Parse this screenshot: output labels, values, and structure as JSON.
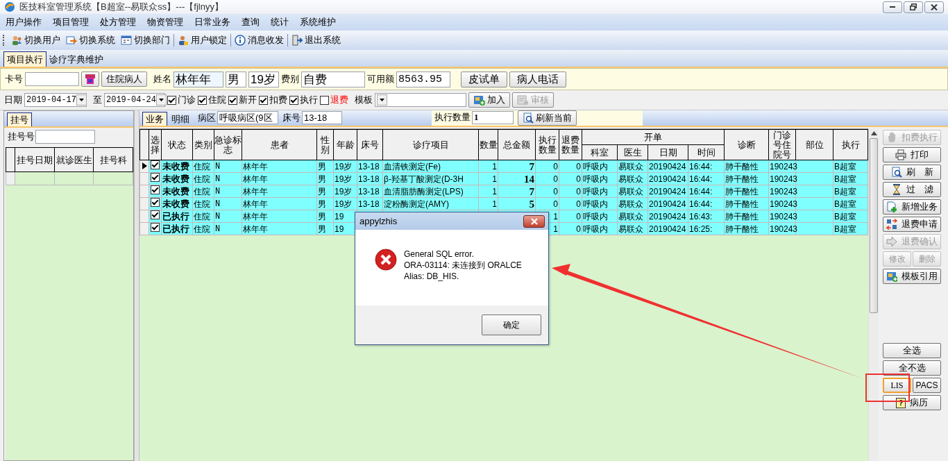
{
  "window": {
    "title": "医技科室管理系统【B超室--易联众ss】---【fjlnyy】"
  },
  "menu": [
    "用户操作",
    "项目管理",
    "处方管理",
    "物资管理",
    "日常业务",
    "查询",
    "统计",
    "系统维护"
  ],
  "toolbar": [
    {
      "label": "切换用户"
    },
    {
      "label": "切换系统"
    },
    {
      "label": "切换部门"
    },
    {
      "label": "用户锁定"
    },
    {
      "label": "消息收发"
    },
    {
      "label": "退出系统"
    }
  ],
  "tabs": [
    {
      "label": "项目执行",
      "selected": true
    },
    {
      "label": "诊疗字典维护",
      "selected": false
    }
  ],
  "patient_bar": {
    "card_no_label": "卡号",
    "inpatient_button": "住院病人",
    "name_label": "姓名",
    "name": "林年年",
    "sex": "男",
    "age": "19岁",
    "fee_type_label": "费别",
    "fee_type": "自费",
    "balance_label": "可用额",
    "balance": "8563.95",
    "buttons": [
      "皮试单",
      "病人电话"
    ]
  },
  "filter_bar": {
    "date_label": "日期",
    "date_from": "2019-04-17",
    "to_label": "至",
    "date_to": "2019-04-24",
    "options": [
      {
        "label": "门诊",
        "checked": true,
        "kind": "normal"
      },
      {
        "label": "住院",
        "checked": true,
        "kind": "normal"
      },
      {
        "label": "新开",
        "checked": true,
        "kind": "normal"
      },
      {
        "label": "扣费",
        "checked": true,
        "kind": "normal"
      },
      {
        "label": "执行",
        "checked": true,
        "kind": "normal"
      },
      {
        "label": "退费",
        "checked": false,
        "kind": "alert"
      }
    ],
    "template_label": "模板",
    "buttons": [
      {
        "label": "加入",
        "disabled": false
      },
      {
        "label": "审核",
        "disabled": true
      }
    ]
  },
  "registration_panel": {
    "tabs": [
      {
        "label": "挂号",
        "selected": true
      }
    ],
    "field_label": "挂号号",
    "columns": [
      "挂号日期",
      "就诊医生",
      "挂号科"
    ]
  },
  "business_panel": {
    "tabs": [
      {
        "label": "业务",
        "selected": true
      },
      {
        "label": "明细",
        "selected": false
      }
    ],
    "ward_label": "病区",
    "ward": "呼吸病区(9区",
    "bed_label": "床号",
    "bed": "13-18",
    "exec_count_label": "执行数量",
    "exec_count": "1",
    "refresh_button": "刷新当前"
  },
  "table": {
    "columns": [
      {
        "label": "选择"
      },
      {
        "label": "状态"
      },
      {
        "label": "类别"
      },
      {
        "label": "急诊标志"
      },
      {
        "label": "患者"
      },
      {
        "label": "性别"
      },
      {
        "label": "年龄"
      },
      {
        "label": "床号"
      },
      {
        "label": "诊疗项目"
      },
      {
        "label": "数量"
      },
      {
        "label": "总金额"
      },
      {
        "label": "执行数量"
      },
      {
        "label": "退费数量"
      },
      {
        "label": "开单",
        "colspan": 4,
        "children": [
          "科室",
          "医生",
          "日期",
          "时间"
        ]
      },
      {
        "label": "诊断"
      },
      {
        "label": "门诊号住院号"
      },
      {
        "label": "部位"
      },
      {
        "label": "执行"
      }
    ],
    "rows": [
      {
        "current": true,
        "checked": true,
        "cells": [
          null,
          "未收费",
          "住院",
          "N",
          "林年年",
          "男",
          "19岁",
          "13-18",
          "血清铁测定(Fe)",
          "1",
          "7",
          "0",
          "0",
          "呼吸内",
          "易联众",
          "20190424",
          "16:44:",
          "肺干酪性",
          "190243",
          null,
          "B超室"
        ]
      },
      {
        "current": false,
        "checked": true,
        "cells": [
          null,
          "未收费",
          "住院",
          "N",
          "林年年",
          "男",
          "19岁",
          "13-18",
          "β-羟基丁酸测定(D-3H",
          "1",
          "14",
          "0",
          "0",
          "呼吸内",
          "易联众",
          "20190424",
          "16:44:",
          "肺干酪性",
          "190243",
          null,
          "B超室"
        ]
      },
      {
        "current": false,
        "checked": true,
        "cells": [
          null,
          "未收费",
          "住院",
          "N",
          "林年年",
          "男",
          "19岁",
          "13-18",
          "血清脂肪酶测定(LPS)",
          "1",
          "7",
          "0",
          "0",
          "呼吸内",
          "易联众",
          "20190424",
          "16:44:",
          "肺干酪性",
          "190243",
          null,
          "B超室"
        ]
      },
      {
        "current": false,
        "checked": true,
        "cells": [
          null,
          "未收费",
          "住院",
          "N",
          "林年年",
          "男",
          "19岁",
          "13-18",
          "淀粉酶测定(AMY)",
          "1",
          "5",
          "0",
          "0",
          "呼吸内",
          "易联众",
          "20190424",
          "16:44:",
          "肺干酪性",
          "190243",
          null,
          "B超室"
        ]
      },
      {
        "current": false,
        "checked": true,
        "cells": [
          null,
          "已执行",
          "住院",
          "N",
          "林年年",
          "男",
          "19",
          null,
          null,
          null,
          null,
          "1",
          "0",
          "呼吸内",
          "易联众",
          "20190424",
          "16:43:",
          "肺干酪性",
          "190243",
          null,
          "B超室"
        ]
      },
      {
        "current": false,
        "checked": true,
        "cells": [
          null,
          "已执行",
          "住院",
          "N",
          "林年年",
          "男",
          "19",
          null,
          null,
          null,
          null,
          "1",
          "0",
          "呼吸内",
          "易联众",
          "20190424",
          "16:25:",
          "肺干酪性",
          "190243",
          null,
          "B超室"
        ]
      }
    ]
  },
  "side_buttons": [
    {
      "kind": "single",
      "label": "扣费执行",
      "disabled": true
    },
    {
      "kind": "single",
      "label": "打印",
      "disabled": false
    },
    {
      "kind": "single",
      "label": "刷　新",
      "disabled": false
    },
    {
      "kind": "single",
      "label": "过　滤",
      "disabled": false
    },
    {
      "kind": "single",
      "label": "新增业务",
      "disabled": false
    },
    {
      "kind": "single",
      "label": "退费申请",
      "disabled": false
    },
    {
      "kind": "single",
      "label": "退费确认",
      "disabled": true
    },
    {
      "kind": "pair",
      "buttons": [
        {
          "label": "修改",
          "disabled": true
        },
        {
          "label": "删除",
          "disabled": true
        }
      ]
    },
    {
      "kind": "single",
      "label": "模板引用",
      "disabled": false
    }
  ],
  "side_buttons_bottom": [
    {
      "kind": "single",
      "label": "全选",
      "disabled": false
    },
    {
      "kind": "single",
      "label": "全不选",
      "disabled": false
    },
    {
      "kind": "pair",
      "buttons": [
        {
          "label": "LIS",
          "disabled": false,
          "selected": true
        },
        {
          "label": "PACS",
          "disabled": false,
          "selected": false
        }
      ]
    },
    {
      "kind": "single",
      "label": "病历",
      "disabled": false,
      "icon_text": "?"
    }
  ],
  "dialog": {
    "title": "appylzhis",
    "message": "General SQL error.\nORA-03114: 未连接到 ORALCE\nAlias: DB_HIS.",
    "button": "确定"
  },
  "annotations": {
    "arrow": true,
    "highlight_box": true
  }
}
